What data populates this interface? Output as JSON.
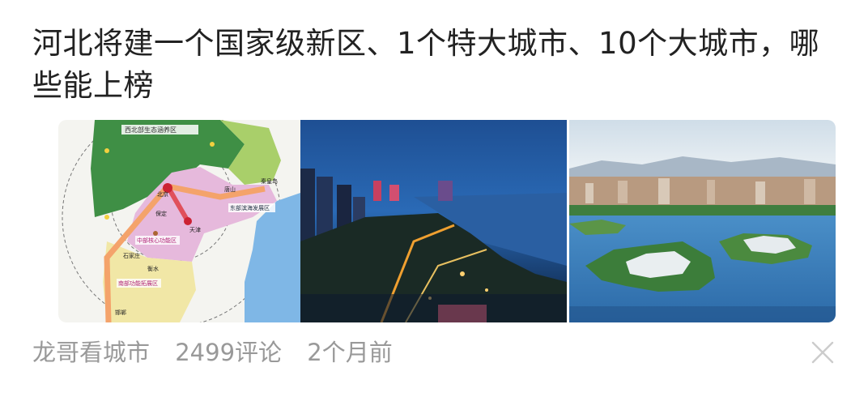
{
  "article": {
    "title": "河北将建一个国家级新区、1个特大城市、10个大城市，哪些能上榜",
    "source": "龙哥看城市",
    "comments": "2499评论",
    "time": "2个月前"
  },
  "map_labels": {
    "nw_zone": "西北部生态涵养区",
    "east_zone": "东部滨海发展区",
    "central_zone": "中部核心功能区",
    "south_zone": "南部功能拓展区",
    "tianjin": "天津",
    "beijing": "北京",
    "shijiazhuang": "石家庄",
    "baoding": "保定",
    "hengshui": "衡水",
    "handan": "邯郸",
    "tangshan": "唐山",
    "qinhuangdao": "秦皇岛"
  },
  "colors": {
    "title": "#222222",
    "meta": "#999999",
    "close": "#cccccc"
  },
  "icons": {
    "close": "close-icon"
  }
}
